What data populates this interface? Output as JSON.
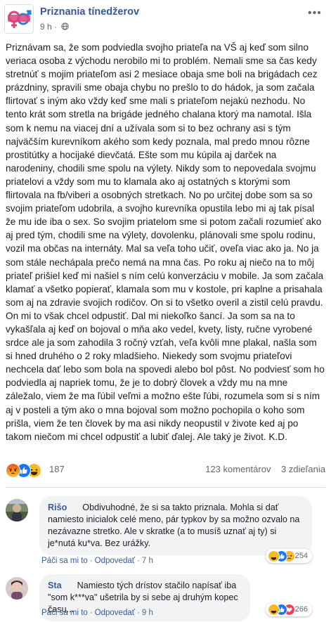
{
  "page": {
    "name": "Priznania tínedžerov",
    "time": "9 h",
    "privacy_icon": "globe-icon"
  },
  "post": {
    "text": "Priznávam sa, že som podviedla svojho priateľa na VŠ aj keď som silno veriaca osoba z východu nerobilo mi to problém. Nemali sme sa čas kedy stretnúť s mojim priateľom asi 2 mesiace obaja sme boli na brigádach cez prázdniny, spravili sme obaja chybu no prešlo to do hádok, ja som začala flirtovať s iným ako vždy keď sme mali s priateľom nejakú nezhodu. No tento krát som stretla na brigáde jedného chalana ktorý ma namotal. Išla som k nemu na viacej dní a užívala som si to bez ochrany asi s tým najväčším kurevníkom akého som kedy poznala, mal predo mnou rôzne prostitútky a hocijaké dievčatá. Ešte som mu kúpila aj darček na narodeniny, chodili sme spolu na výlety. Nikdy som to nepovedala svojmu priatelovi a vždy som mu to klamala ako aj ostatných s ktorými som flirtovala na fb/viberi a osobných stretkach. No po určitej dobe som sa so svojim priateľom udobrila, a svojho kurevníka opustila lebo mi aj tak písal že mu ide iba o sex. So svojim priatelom sme si potom začali rozumieť ako aj pred tým, chodili sme na výlety, dovolenku, plánovali sme spolu rodinu, vozil ma občas na internáty. Mal sa veľa toho učiť, oveľa viac ako ja. No ja som stále nechápala prečo nemá na mna čas. Po roku aj niečo na to môj priateľ prišiel keď mi našiel s ním celú konverzáciu v mobile. Ja som začala klamať a všetko popierať, klamala som mu v kostole, pri kaplne a prisahala som aj na zdravie svojich rodičov. On si to všetko overil a zistil celú pravdu. On mi to však chcel odpustiť. Dal mi niekoľko šancí. Ja som sa na to vykašľala aj keď on bojoval o mňa ako vedel, kvety, listy, ručne vyrobené srdce ale ja som zahodila 3 ročný vzťah, veľa kvôli mne plakal, našla som si hned druhého o 2 roky mladšieho. Niekedy som svojmu priateľovi nechcela dať lebo som bola na spovedi alebo bol pôst. No podviesť som ho podviedla aj napriek tomu, že je to dobrý človek a vždy mu na mne záležalo, viem že ma ľúbil veľmi a možno ešte ľúbi, rozumela som si s ním aj v posteli a tým ako o mna bojoval som možno pochopila o koho som prišla, viem že ten človek by ma asi nikdy neopustil v živote ked aj po takom niečom mi chcel odpustiť a lubiť ďalej. Ale taký je život. K.D."
  },
  "reactions": {
    "icons": [
      "angry-icon",
      "like-icon",
      "haha-icon"
    ],
    "count": "187",
    "comments": "123 komentárov",
    "shares": "3 zdieľania"
  },
  "comments": [
    {
      "author": "Rišo",
      "text": "Obdivuhodné, že si sa takto priznala. Mohla si dať namiesto inicialok celé meno, pár typkov by sa možno ozvalo na nezávazne stretko. Ale v skratke (a to musíš uznať aj ty) si je*nutá ku*va. Bez urážky.",
      "like": "Páči sa mi to",
      "reply": "Odpovedať",
      "time": "7 h",
      "reaction_icons": [
        "haha-icon",
        "like-icon",
        "sad-icon"
      ],
      "reaction_count": "254"
    },
    {
      "author": "Sta",
      "text": "Namiesto tých drístov stačilo napísať iba \"som k***va\" ušetrila by si sebe aj druhým kopec času...",
      "like": "Páči sa mi to",
      "reply": "Odpovedať",
      "time": "9 h",
      "reaction_icons": [
        "haha-icon",
        "like-icon",
        "love-icon"
      ],
      "reaction_count": "266"
    }
  ],
  "colors": {
    "link": "#385898",
    "like": "#1877f2",
    "haha": "#f7b928",
    "angry": "#e4571a",
    "love": "#f33e58"
  }
}
